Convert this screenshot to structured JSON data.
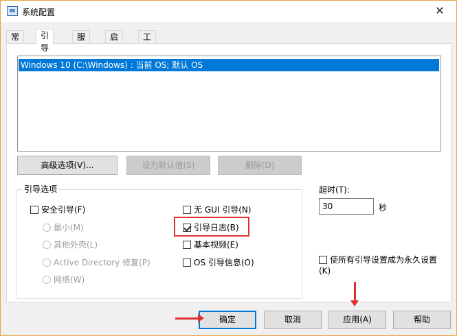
{
  "window": {
    "title": "系统配置",
    "close_glyph": "✕"
  },
  "tabs": [
    {
      "label": "常规"
    },
    {
      "label": "引导"
    },
    {
      "label": "服务"
    },
    {
      "label": "启动"
    },
    {
      "label": "工具"
    }
  ],
  "active_tab": "引导",
  "os_list": {
    "items": [
      "Windows 10 (C:\\Windows) : 当前 OS; 默认 OS"
    ],
    "selected_index": 0
  },
  "os_buttons": {
    "advanced": "高级选项(V)...",
    "set_default": "设为默认值(S)",
    "delete": "删除(D)"
  },
  "boot_options": {
    "group_label": "引导选项",
    "safe_boot": {
      "label": "安全引导(F)",
      "checked": false
    },
    "radios": [
      {
        "label": "最小(M)",
        "enabled": false
      },
      {
        "label": "其他外壳(L)",
        "enabled": false
      },
      {
        "label": "Active Directory 修复(P)",
        "enabled": false
      },
      {
        "label": "网络(W)",
        "enabled": false
      }
    ],
    "no_gui": {
      "label": "无 GUI 引导(N)",
      "checked": false
    },
    "boot_log": {
      "label": "引导日志(B)",
      "checked": true
    },
    "base_video": {
      "label": "基本视频(E)",
      "checked": false
    },
    "os_boot_info": {
      "label": "OS 引导信息(O)",
      "checked": false
    }
  },
  "timeout": {
    "label": "超时(T):",
    "value": "30",
    "unit": "秒"
  },
  "permanent": {
    "label": "使所有引导设置成为永久设置(K)",
    "checked": false
  },
  "dialog_buttons": {
    "ok": "确定",
    "cancel": "取消",
    "apply": "应用(A)",
    "help": "帮助"
  },
  "colors": {
    "accent": "#0078d7",
    "annotation": "#e03030",
    "window_border": "#e8a33c"
  }
}
